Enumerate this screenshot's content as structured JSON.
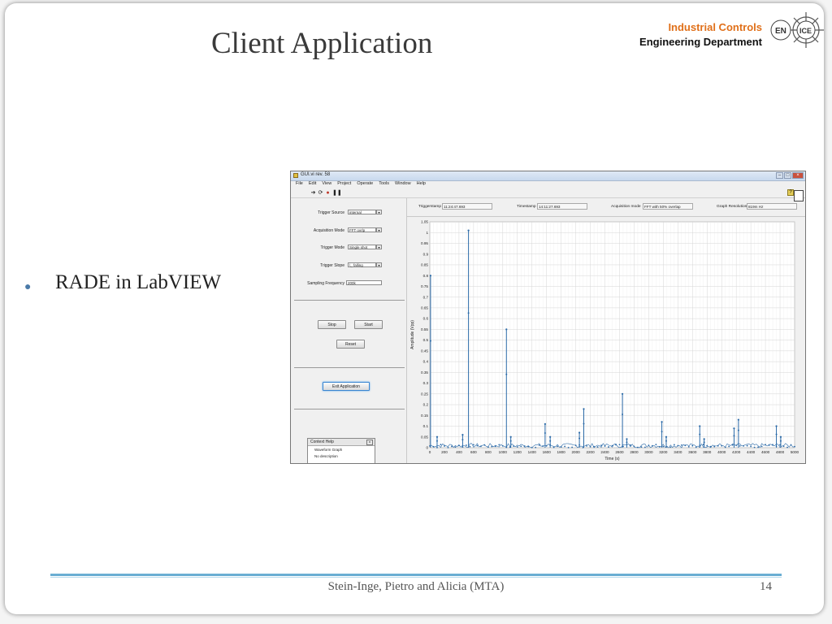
{
  "slide": {
    "title": "Client Application",
    "logo": {
      "line1": "Industrial Controls",
      "line2": "Engineering Department",
      "badge_left": "EN",
      "badge_right": "ICE"
    },
    "bullet": "RADE in LabVIEW",
    "footer": "Stein-Inge, Pietro and Alicia (MTA)",
    "page_number": "14",
    "colors": {
      "accent_orange": "#e0701a",
      "rule_blue": "#6aaed3",
      "bullet_blue": "#4a7aa8"
    }
  },
  "app": {
    "window_title": "GUI.vi rev. 58",
    "menu": [
      "File",
      "Edit",
      "View",
      "Project",
      "Operate",
      "Tools",
      "Window",
      "Help"
    ],
    "toolbar_icons": [
      "run-arrow-icon",
      "run-continuous-icon",
      "abort-icon",
      "pause-icon"
    ],
    "controls": [
      {
        "label": "Trigger Source",
        "value": "internal"
      },
      {
        "label": "Acquisition Mode",
        "value": "FFT ovrlp"
      },
      {
        "label": "Trigger Mode",
        "value": "Single shot"
      },
      {
        "label": "Trigger Slope",
        "value": "\\_ falling"
      }
    ],
    "sampling": {
      "label": "Sampling Frequency",
      "value": "200k"
    },
    "buttons": {
      "stop": "Stop",
      "start": "Start",
      "reset": "Reset",
      "exit": "Exit Application"
    },
    "context_help": {
      "title": "Context Help",
      "heading": "Waveform Graph",
      "text": "No description",
      "close": "x"
    },
    "info": [
      {
        "label": "Triggerstamp",
        "value": "11:24:47.693"
      },
      {
        "label": "Timestamp",
        "value": "14:11:27.693"
      },
      {
        "label": "Acquisition mode",
        "value": "FFT with 50% overlap"
      },
      {
        "label": "Graph Resolution",
        "value": "819m Hz"
      }
    ]
  },
  "chart_data": {
    "type": "line",
    "title": "",
    "xlabel": "Time (s)",
    "ylabel": "Amplitude (Vpp)",
    "xlim": [
      0,
      5000
    ],
    "ylim": [
      0,
      1.05
    ],
    "grid": true,
    "x_ticks": [
      0,
      200,
      400,
      600,
      800,
      1000,
      1200,
      1400,
      1600,
      1800,
      2000,
      2200,
      2400,
      2600,
      2800,
      3000,
      3200,
      3400,
      3600,
      3800,
      4000,
      4200,
      4400,
      4600,
      4800,
      5000
    ],
    "y_ticks": [
      0,
      0.05,
      0.1,
      0.15,
      0.2,
      0.25,
      0.3,
      0.35,
      0.4,
      0.45,
      0.5,
      0.55,
      0.6,
      0.65,
      0.7,
      0.75,
      0.8,
      0.85,
      0.9,
      0.95,
      1,
      1.05
    ],
    "series_color": "#2b6aa8",
    "peaks": [
      {
        "x": 10,
        "y": 0.8
      },
      {
        "x": 100,
        "y": 0.05
      },
      {
        "x": 450,
        "y": 0.06
      },
      {
        "x": 530,
        "y": 1.01
      },
      {
        "x": 1050,
        "y": 0.55
      },
      {
        "x": 1110,
        "y": 0.05
      },
      {
        "x": 1580,
        "y": 0.11
      },
      {
        "x": 1650,
        "y": 0.05
      },
      {
        "x": 2050,
        "y": 0.07
      },
      {
        "x": 2110,
        "y": 0.18
      },
      {
        "x": 2640,
        "y": 0.25
      },
      {
        "x": 2700,
        "y": 0.04
      },
      {
        "x": 3180,
        "y": 0.12
      },
      {
        "x": 3240,
        "y": 0.05
      },
      {
        "x": 3700,
        "y": 0.1
      },
      {
        "x": 3760,
        "y": 0.04
      },
      {
        "x": 4170,
        "y": 0.09
      },
      {
        "x": 4230,
        "y": 0.13
      },
      {
        "x": 4750,
        "y": 0.1
      },
      {
        "x": 4810,
        "y": 0.05
      }
    ]
  }
}
